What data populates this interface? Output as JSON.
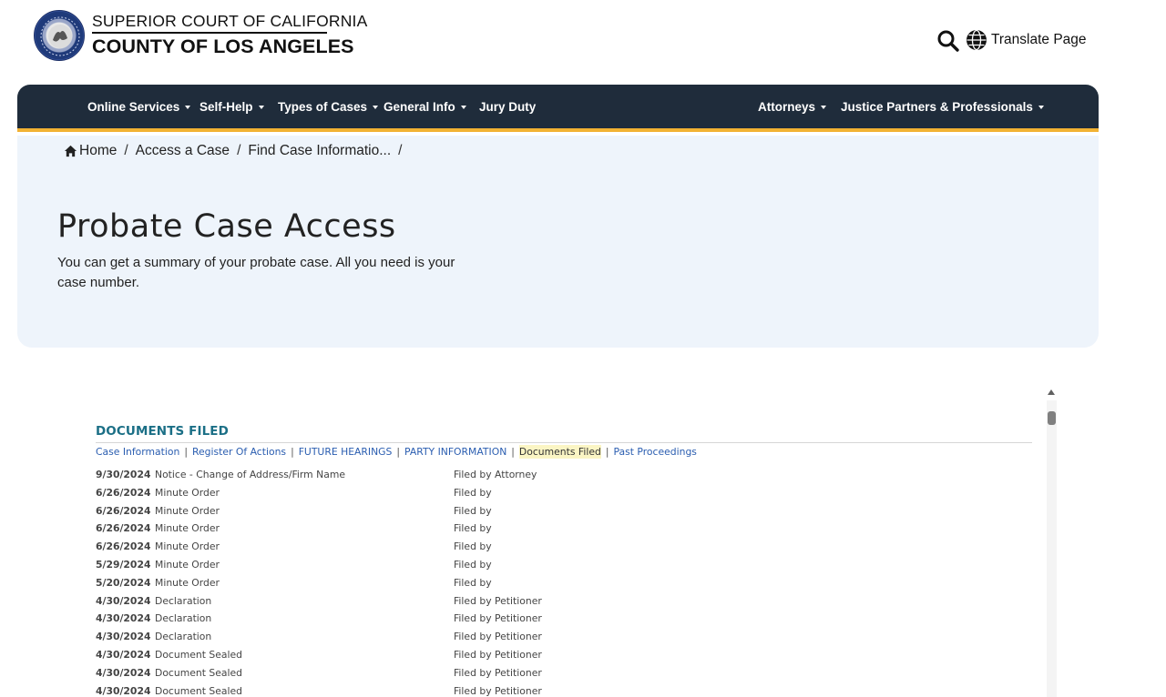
{
  "header": {
    "court_line1": "SUPERIOR COURT OF CALIFORNIA",
    "court_line2": "COUNTY OF LOS ANGELES",
    "search_icon": "search-icon",
    "translate_label": "Translate Page",
    "translate_icon": "globe-icon"
  },
  "nav": {
    "left": [
      {
        "label": "Online Services"
      },
      {
        "label": "Self-Help"
      },
      {
        "label": "Types of Cases"
      },
      {
        "label": "General Info"
      },
      {
        "label": "Jury Duty"
      }
    ],
    "right": [
      {
        "label": "Attorneys"
      },
      {
        "label": "Justice Partners & Professionals"
      }
    ]
  },
  "breadcrumb": {
    "home": "Home",
    "access": "Access a Case",
    "find": "Find Case Informatio...",
    "sep": "/"
  },
  "hero": {
    "title": "Probate Case Access",
    "description": "You can get a summary of your probate case. All you need is your case number."
  },
  "documents": {
    "heading": "DOCUMENTS FILED",
    "tabs": [
      {
        "label": "Case Information"
      },
      {
        "label": "Register Of Actions"
      },
      {
        "label": "FUTURE HEARINGS"
      },
      {
        "label": "PARTY INFORMATION"
      },
      {
        "label": "Documents Filed"
      },
      {
        "label": "Past Proceedings"
      }
    ],
    "tab_sep": "|",
    "rows": [
      {
        "date": "9/30/2024",
        "desc": "Notice - Change of Address/Firm Name",
        "filed": "Filed by Attorney"
      },
      {
        "date": "6/26/2024",
        "desc": "Minute Order",
        "filed": "Filed by"
      },
      {
        "date": "6/26/2024",
        "desc": "Minute Order",
        "filed": "Filed by"
      },
      {
        "date": "6/26/2024",
        "desc": "Minute Order",
        "filed": "Filed by"
      },
      {
        "date": "6/26/2024",
        "desc": "Minute Order",
        "filed": "Filed by"
      },
      {
        "date": "5/29/2024",
        "desc": "Minute Order",
        "filed": "Filed by"
      },
      {
        "date": "5/20/2024",
        "desc": "Minute Order",
        "filed": "Filed by"
      },
      {
        "date": "4/30/2024",
        "desc": "Declaration",
        "filed": "Filed by Petitioner"
      },
      {
        "date": "4/30/2024",
        "desc": "Declaration",
        "filed": "Filed by Petitioner"
      },
      {
        "date": "4/30/2024",
        "desc": "Declaration",
        "filed": "Filed by Petitioner"
      },
      {
        "date": "4/30/2024",
        "desc": "Document Sealed",
        "filed": "Filed by Petitioner"
      },
      {
        "date": "4/30/2024",
        "desc": "Document Sealed",
        "filed": "Filed by Petitioner"
      },
      {
        "date": "4/30/2024",
        "desc": "Document Sealed",
        "filed": "Filed by Petitioner"
      }
    ]
  },
  "colors": {
    "nav_bg": "#1f2c3b",
    "nav_accent": "#f2b233",
    "hero_bg": "#eef4fb",
    "heading_teal": "#1b6f86",
    "link_blue": "#2a5db0",
    "active_tab_bg": "#fbf5c4"
  }
}
